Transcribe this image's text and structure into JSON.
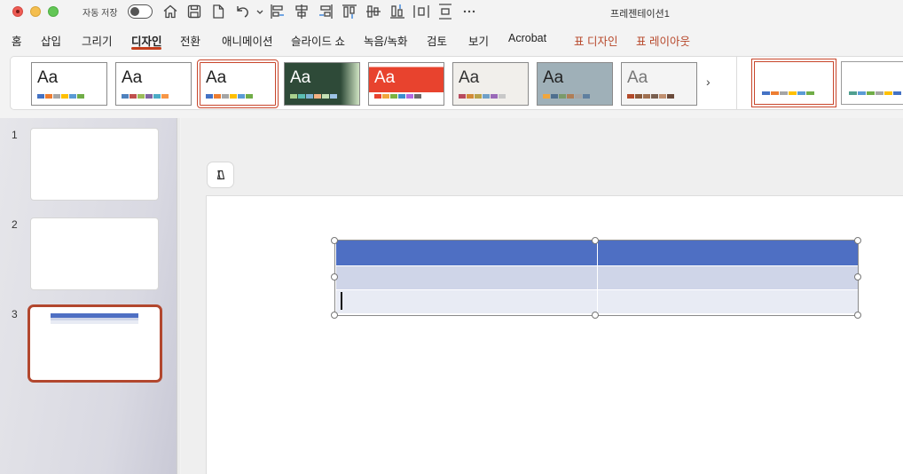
{
  "titlebar": {
    "autosave_label": "자동 저장",
    "autosave_state": "off",
    "doc_title": "프레젠테이션1",
    "icons": [
      "home-icon",
      "save-icon",
      "new-doc-icon",
      "undo-icon",
      "align-left-icon",
      "align-center-icon",
      "align-right-icon",
      "align-top-icon",
      "align-middle-icon",
      "align-bottom-icon",
      "distribute-horizontal-icon",
      "distribute-vertical-icon",
      "more-icon"
    ]
  },
  "menu": {
    "items": [
      "홈",
      "삽입",
      "그리기",
      "디자인",
      "전환",
      "애니메이션",
      "슬라이드 쇼",
      "녹음/녹화",
      "검토",
      "보기",
      "Acrobat",
      "표 디자인",
      "표 레이아웃"
    ],
    "active": "디자인"
  },
  "ribbon": {
    "theme_label": "Aa",
    "themes": [
      {
        "bg": "#ffffff",
        "fg": "#222222",
        "sw": [
          "#4472c4",
          "#ed7d31",
          "#a5a5a5",
          "#ffc000",
          "#5b9bd5",
          "#70ad47"
        ]
      },
      {
        "bg": "#ffffff",
        "fg": "#222222",
        "sw": [
          "#4f81bd",
          "#c0504d",
          "#9bbb59",
          "#8064a2",
          "#4bacc6",
          "#f79646"
        ]
      },
      {
        "bg": "#ffffff",
        "fg": "#222222",
        "sw": [
          "#4472c4",
          "#ed7d31",
          "#a5a5a5",
          "#ffc000",
          "#5b9bd5",
          "#70ad47"
        ],
        "selected": true
      },
      {
        "bg": "#2e4a38",
        "fg": "#ffffff",
        "sw": [
          "#a9d18e",
          "#5bbdb2",
          "#7fb3d5",
          "#f4b183",
          "#c5e0b4",
          "#9dc3e6"
        ]
      },
      {
        "bg": "#e8432e",
        "fg": "#ffffff",
        "sw": [
          "#e8432e",
          "#f1a63c",
          "#7cb342",
          "#3b8ed0",
          "#b36ae2",
          "#6b6b6b"
        ]
      },
      {
        "bg": "#f1efeb",
        "fg": "#333333",
        "sw": [
          "#b84a5e",
          "#d38b36",
          "#b8a24a",
          "#6fa0c8",
          "#9a6ab8",
          "#c8c8c8"
        ]
      },
      {
        "bg": "#9fb0b8",
        "fg": "#222222",
        "sw": [
          "#f1a63c",
          "#4f6f8f",
          "#7a9a6a",
          "#b07d56",
          "#a5a5a5",
          "#5f7f9f"
        ]
      },
      {
        "bg": "#f4f4f4",
        "fg": "#777777",
        "sw": [
          "#b34a2a",
          "#8a5a3a",
          "#a07050",
          "#7a6050",
          "#c09070",
          "#6a4a3a"
        ]
      }
    ],
    "table_styles": [
      {
        "sw": [
          "#4472c4",
          "#ed7d31",
          "#a5a5a5",
          "#ffc000",
          "#5b9bd5",
          "#70ad47"
        ],
        "selected": true
      },
      {
        "sw": [
          "#4f9f8f",
          "#5b9bd5",
          "#70ad47",
          "#a5a5a5",
          "#ffc000",
          "#4472c4"
        ]
      }
    ]
  },
  "slides": {
    "numbers": [
      "1",
      "2",
      "3"
    ],
    "selected": "3"
  },
  "table": {
    "columns": 2,
    "rows": 3,
    "header_color": "#4e6fc3",
    "band1_color": "#cfd5e8",
    "band2_color": "#e8ebf4",
    "accent_color": "#c43e1c"
  }
}
